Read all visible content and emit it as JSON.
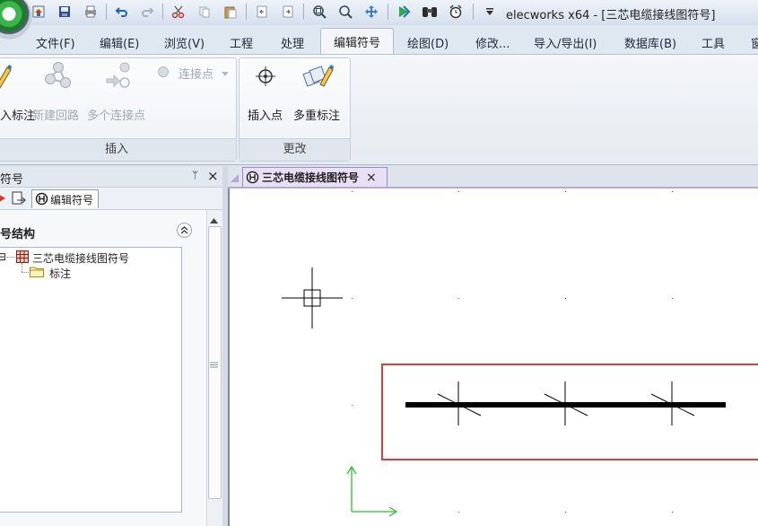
{
  "window": {
    "title": "elecworks x64 - [三芯电缆接线图符号]",
    "quick_access_icons": [
      "home-icon",
      "save-icon",
      "print-icon",
      "undo-icon",
      "redo-icon",
      "cut-icon",
      "copy-icon",
      "paste-icon",
      "page-prev-icon",
      "page-next-icon",
      "zoom-window-icon",
      "zoom-icon",
      "pan-icon",
      "play-icon",
      "binoculars-icon",
      "alarm-icon",
      "customize-arrow-icon"
    ]
  },
  "ribbon": {
    "tabs": [
      "文件(F)",
      "编辑(E)",
      "浏览(V)",
      "工程",
      "处理",
      "编辑符号",
      "绘图(D)",
      "修改...",
      "导入/导出(I)",
      "数据库(B)",
      "工具",
      "窗"
    ],
    "active_tab": "编辑符号",
    "insert_group": {
      "label": "插入",
      "buttons": {
        "insert_annotation": "入标注",
        "new_loop": "新建回路",
        "multi_connect": "多个连接点",
        "connect_point": "连接点"
      }
    },
    "modify_group": {
      "label": "更改",
      "buttons": {
        "insert_point": "插入点",
        "multi_annotation": "多重标注"
      }
    }
  },
  "left_panel": {
    "title": "符号",
    "pin_glyph": "ᛘ",
    "close_glyph": "×",
    "tool_tab_label": "编辑符号",
    "section_title": "号结构",
    "tree": {
      "root": "三芯电缆接线图符号",
      "child": "标注",
      "expander": "⊟"
    }
  },
  "document": {
    "tab_label": "三芯电缆接线图符号",
    "tab_close": "×"
  },
  "colors": {
    "selection_box": "#e03c3c",
    "ucs_axis": "#2fbf2f",
    "cable_line": "#000000",
    "active_doc_tab": "#e8e0f4"
  }
}
